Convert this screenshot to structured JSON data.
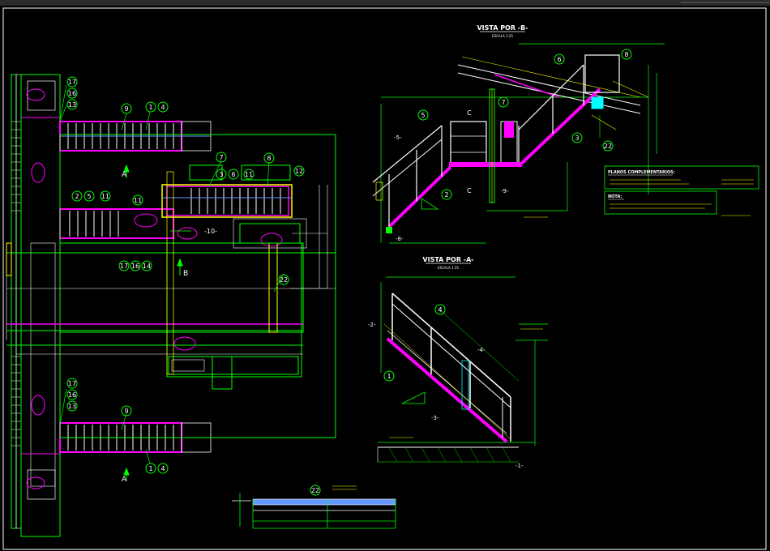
{
  "colors": {
    "background": "#000000",
    "frame": "#ffffff",
    "green": "#00ff00",
    "white": "#ffffff",
    "magenta": "#ff00ff",
    "yellow": "#ffff00",
    "red": "#ff0000",
    "cyan": "#00ffff",
    "blue": "#6699ff",
    "purple": "#9933cc"
  },
  "views": {
    "view_b": {
      "title": "VISTA POR -B-",
      "scale": "ESCALA 1:25"
    },
    "view_a": {
      "title": "VISTA POR -A-",
      "scale": "ESCALA 1:15"
    }
  },
  "notes": {
    "planos_title": "PLANOS COMPLEMENTARIOS:",
    "nota_title": "NOTA:"
  },
  "section_marks": {
    "a_top": "A",
    "a_bottom": "A",
    "b_mark": "B",
    "c_upper": "C",
    "c_lower": "C"
  },
  "callouts_plan": {
    "c17a": "17",
    "c16a": "16",
    "c13a": "13",
    "c9a": "9",
    "c1a": "1",
    "c4a": "4",
    "c7": "7",
    "c8": "8",
    "c3": "3",
    "c6": "6",
    "c11a": "11",
    "c12": "12",
    "c2": "2",
    "c5": "5",
    "c11b": "11",
    "c11c": "11",
    "c17b": "17",
    "c16b": "16",
    "c14": "14",
    "c22": "22",
    "c17c": "17",
    "c16c": "16",
    "c13c": "13",
    "c9b": "9",
    "c1b": "1",
    "c4b": "4",
    "c22b": "22"
  },
  "callouts_b": {
    "c6": "6",
    "c8": "8",
    "c7": "7",
    "c5": "5",
    "c3": "3",
    "c22": "22",
    "c2": "2"
  },
  "callouts_a": {
    "c4": "4",
    "c1": "1"
  },
  "dim_labels": {
    "m10": "-10-",
    "m5": "-5-",
    "m9": "-9-",
    "m8": "-8-",
    "m2": "-2-",
    "m4": "-4-",
    "m3": "-3-",
    "m1": "-1-"
  }
}
